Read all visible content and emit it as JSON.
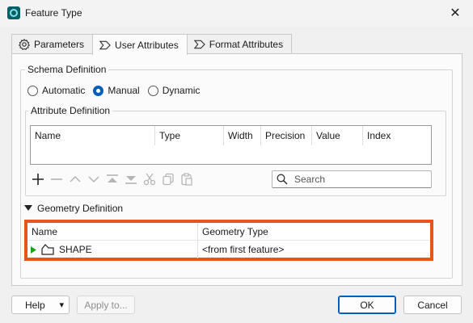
{
  "window": {
    "title": "Feature Type",
    "close_glyph": "✕"
  },
  "tabs": [
    {
      "label": "Parameters",
      "icon": "gear-icon",
      "active": false
    },
    {
      "label": "User Attributes",
      "icon": "user-attributes-icon",
      "active": true
    },
    {
      "label": "Format Attributes",
      "icon": "format-attributes-icon",
      "active": false
    }
  ],
  "schema": {
    "title": "Schema Definition",
    "options": [
      {
        "label": "Automatic",
        "selected": false
      },
      {
        "label": "Manual",
        "selected": true
      },
      {
        "label": "Dynamic",
        "selected": false
      }
    ]
  },
  "attributes": {
    "title": "Attribute Definition",
    "columns": [
      "Name",
      "Type",
      "Width",
      "Precision",
      "Value",
      "Index"
    ],
    "search_placeholder": "Search"
  },
  "geometry": {
    "title": "Geometry Definition",
    "columns": [
      "Name",
      "Geometry Type"
    ],
    "rows": [
      {
        "name": "SHAPE",
        "geometry_type": "<from first feature>"
      }
    ]
  },
  "footer": {
    "help_label": "Help",
    "help_arrow": "▾",
    "apply_label": "Apply to...",
    "ok_label": "OK",
    "cancel_label": "Cancel"
  },
  "colors": {
    "highlight": "#e8541e",
    "accent": "#005fb8"
  }
}
